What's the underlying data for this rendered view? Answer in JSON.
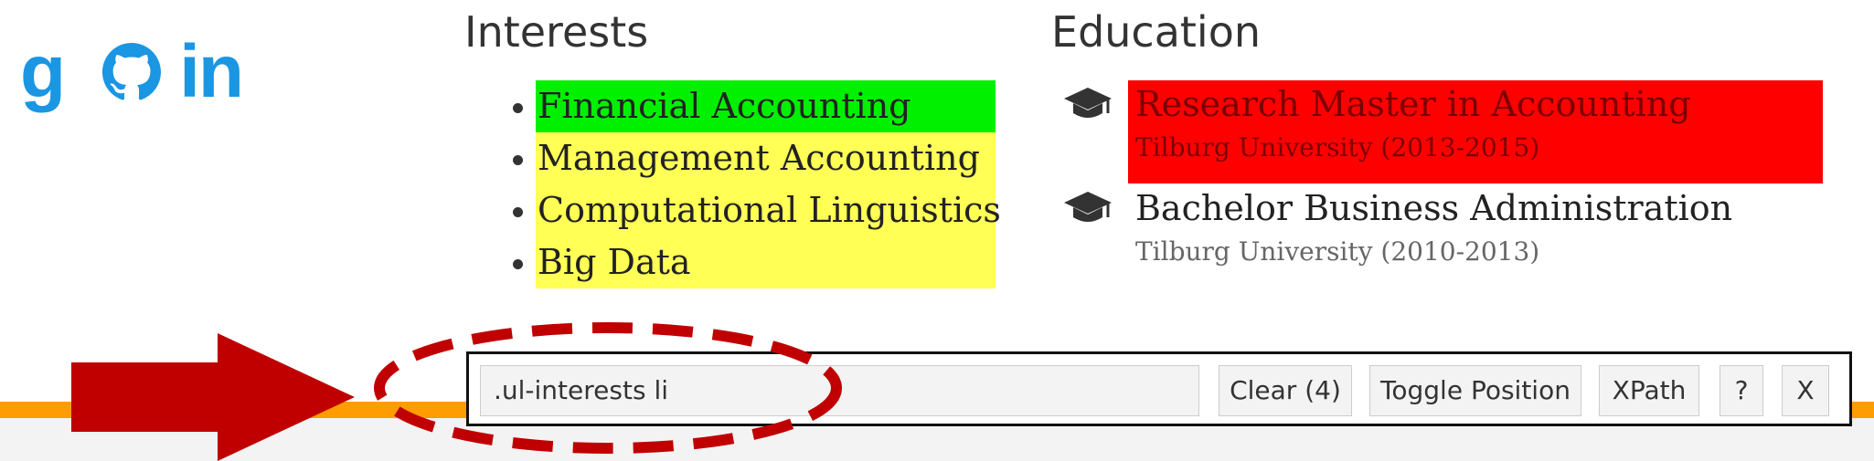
{
  "social": {
    "scholar_icon": "google-scholar-icon",
    "scholar_glyph": "g",
    "github_icon": "github-icon",
    "linkedin_icon": "linkedin-icon",
    "linkedin_glyph": "in",
    "color": "#1a96e3"
  },
  "interests": {
    "heading": "Interests",
    "items": [
      {
        "label": "Financial Accounting",
        "highlight": "#00f000"
      },
      {
        "label": "Management Accounting",
        "highlight": "#ffff55"
      },
      {
        "label": "Computational Linguistics",
        "highlight": "#ffff55"
      },
      {
        "label": "Big Data",
        "highlight": "#ffff55"
      }
    ]
  },
  "education": {
    "heading": "Education",
    "icon": "graduation-cap-icon",
    "items": [
      {
        "title": "Research Master in Accounting",
        "subtitle": "Tilburg University (2013-2015)",
        "highlight": "#ff0000"
      },
      {
        "title": "Bachelor Business Administration",
        "subtitle": "Tilburg University (2010-2013)"
      }
    ]
  },
  "toolbar": {
    "selector_value": ".ul-interests li",
    "clear_label": "Clear (4)",
    "toggle_label": "Toggle Position",
    "xpath_label": "XPath",
    "help_label": "?",
    "close_label": "X"
  },
  "annotation": {
    "arrow_color": "#c00000",
    "ellipse_color": "#c00000"
  },
  "colors": {
    "footer_band": "#ff9d00"
  }
}
